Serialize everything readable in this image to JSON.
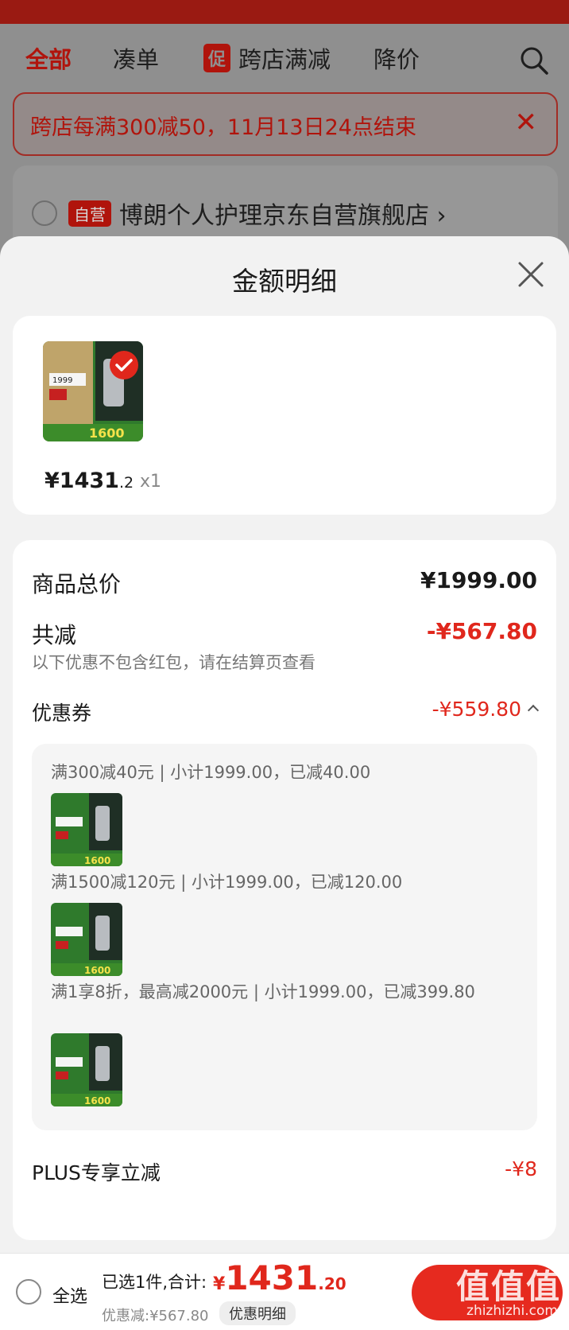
{
  "tabs": [
    "全部",
    "凑单",
    "跨店满减",
    "降价"
  ],
  "promo_tag": "促",
  "notice": {
    "text": "跨店每满300减50，11月13日24点结束"
  },
  "store": {
    "badge": "自营",
    "name": "博朗个人护理京东自营旗舰店 ›"
  },
  "sheet": {
    "title": "金额明细",
    "product": {
      "price_int": "¥1431",
      "price_dec": ".2",
      "qty": "x1",
      "image_text": {
        "price": "1999",
        "coupon": "1600"
      }
    },
    "total_label": "商品总价",
    "total_value": "¥1999.00",
    "reduce_label": "共减",
    "reduce_value": "-¥567.80",
    "reduce_note": "以下优惠不包含红包，请在结算页查看",
    "coupon_label": "优惠券",
    "coupon_value": "-¥559.80",
    "coupons": [
      "满300减40元 | 小计1999.00，已减40.00",
      "满1500减120元 | 小计1999.00，已减120.00",
      "满1享8折，最高减2000元 | 小计1999.00，已减399.80"
    ],
    "plus_label": "PLUS专享立减",
    "plus_value": "-¥8"
  },
  "bottom": {
    "select_all": "全选",
    "summary": "已选1件,合计:",
    "total_cur": "¥",
    "total_int": "1431",
    "total_dec": ".20",
    "discount": "优惠减:¥567.80",
    "detail_button": "优惠明细",
    "watermark": "值值值",
    "watermark_sub": "zhizhizhi.com"
  },
  "colors": {
    "accent": "#e0271c",
    "dark_red": "#b0140c",
    "sheet_bg": "#f2f2f2"
  }
}
